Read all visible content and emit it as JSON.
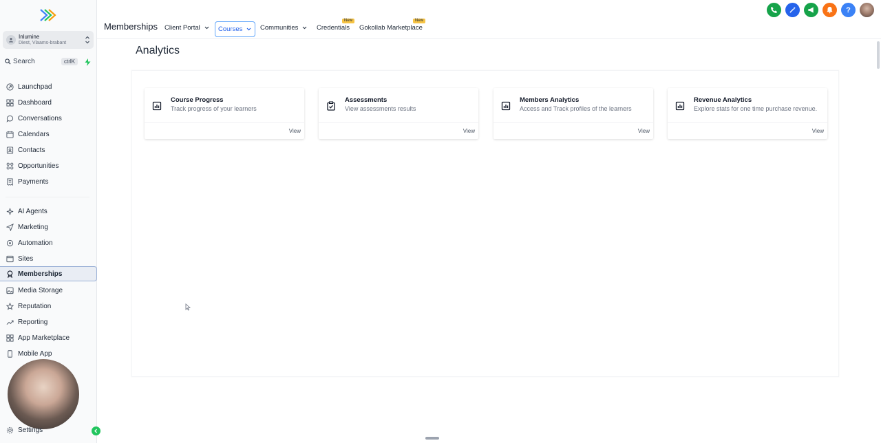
{
  "sidebar": {
    "account": {
      "name": "Inlumine",
      "location": "Diest, Vlaams-brabant"
    },
    "search": {
      "label": "Search",
      "shortcut": "ctrlK"
    },
    "nav": [
      {
        "label": "Launchpad",
        "icon": "launchpad-icon"
      },
      {
        "label": "Dashboard",
        "icon": "dashboard-icon"
      },
      {
        "label": "Conversations",
        "icon": "chat-icon"
      },
      {
        "label": "Calendars",
        "icon": "calendar-icon"
      },
      {
        "label": "Contacts",
        "icon": "contacts-icon"
      },
      {
        "label": "Opportunities",
        "icon": "opportunities-icon"
      },
      {
        "label": "Payments",
        "icon": "payments-icon"
      }
    ],
    "nav2": [
      {
        "label": "AI Agents",
        "icon": "sparkle-icon"
      },
      {
        "label": "Marketing",
        "icon": "send-icon"
      },
      {
        "label": "Automation",
        "icon": "automation-icon"
      },
      {
        "label": "Sites",
        "icon": "sites-icon"
      },
      {
        "label": "Memberships",
        "icon": "award-icon"
      },
      {
        "label": "Media Storage",
        "icon": "image-icon"
      },
      {
        "label": "Reputation",
        "icon": "star-icon"
      },
      {
        "label": "Reporting",
        "icon": "trend-icon"
      },
      {
        "label": "App Marketplace",
        "icon": "grid-icon"
      },
      {
        "label": "Mobile App",
        "icon": "mobile-icon"
      }
    ],
    "settings": "Settings"
  },
  "topbar": {
    "title": "Memberships",
    "tabs": [
      {
        "label": "Client Portal"
      },
      {
        "label": "Courses"
      },
      {
        "label": "Communities"
      },
      {
        "label": "Credentials",
        "badge": "New"
      },
      {
        "label": "Gokollab Marketplace",
        "badge": "New"
      }
    ],
    "icon_colors": {
      "phone": "#16a34a",
      "magic": "#2563eb",
      "megaphone": "#16a34a",
      "bell": "#f97316",
      "help": "#3b82f6"
    }
  },
  "main": {
    "heading": "Analytics",
    "cards": [
      {
        "title": "Course Progress",
        "desc": "Track progress of your learners",
        "view": "View",
        "icon": "chart-icon"
      },
      {
        "title": "Assessments",
        "desc": "View assessments results",
        "view": "View",
        "icon": "clipboard-check-icon"
      },
      {
        "title": "Members Analytics",
        "desc": "Access and Track profiles of the learners",
        "view": "View",
        "icon": "chart-icon"
      },
      {
        "title": "Revenue Analytics",
        "desc": "Explore stats for one time purchase revenue.",
        "view": "View",
        "icon": "chart-icon"
      }
    ]
  }
}
